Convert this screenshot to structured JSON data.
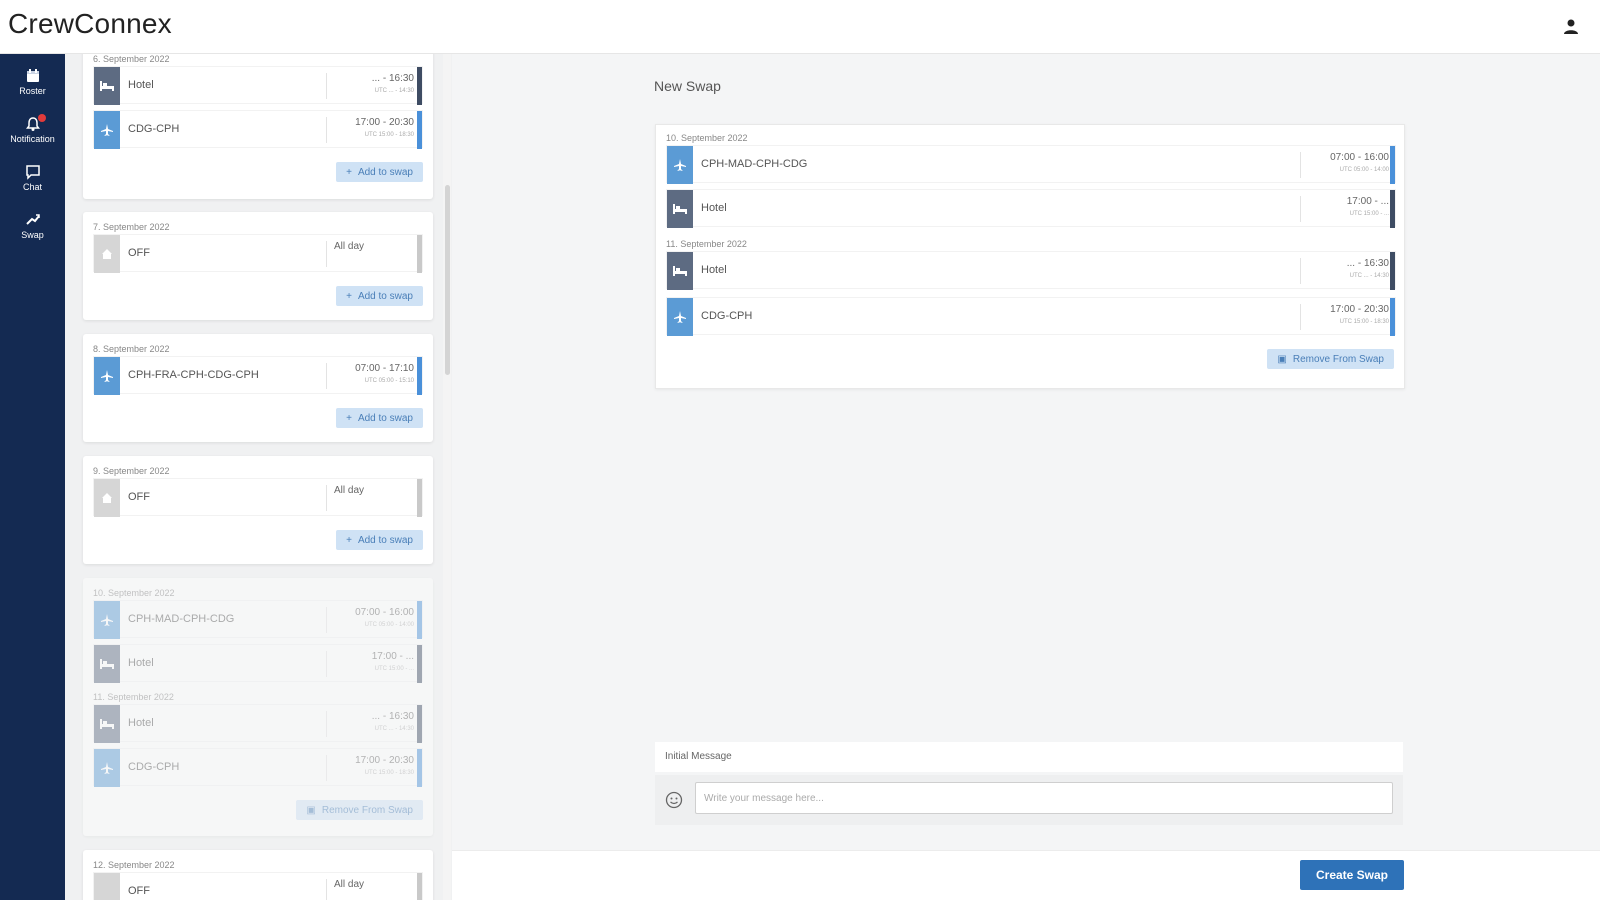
{
  "app": {
    "title": "CrewConnex"
  },
  "nav": {
    "items": [
      {
        "label": "Roster",
        "icon": "calendar-icon"
      },
      {
        "label": "Notification",
        "icon": "bell-icon",
        "badge": true
      },
      {
        "label": "Chat",
        "icon": "chat-icon"
      },
      {
        "label": "Swap",
        "icon": "swap-icon"
      }
    ]
  },
  "colors": {
    "sidebar": "#142a52",
    "flight": "#5b9bd5",
    "hotel": "#5d6b82",
    "primary": "#2e72b8",
    "badge": "#e23b3b"
  },
  "roster_list": {
    "cards": [
      {
        "date": "6. September 2022",
        "duties": [
          {
            "type": "hotel",
            "name": "Hotel",
            "time": "... - 16:30",
            "utc": "UTC ... - 14:30"
          },
          {
            "type": "flight",
            "name": "CDG-CPH",
            "time": "17:00 - 20:30",
            "utc": "UTC 15:00 - 18:30"
          }
        ],
        "action": "Add to swap"
      },
      {
        "date": "7. September 2022",
        "duties": [
          {
            "type": "off",
            "name": "OFF",
            "time": "All day",
            "utc": ""
          }
        ],
        "action": "Add to swap"
      },
      {
        "date": "8. September 2022",
        "duties": [
          {
            "type": "flight",
            "name": "CPH-FRA-CPH-CDG-CPH",
            "time": "07:00 - 17:10",
            "utc": "UTC 05:00 - 15:10"
          }
        ],
        "action": "Add to swap"
      },
      {
        "date": "9. September 2022",
        "duties": [
          {
            "type": "off",
            "name": "OFF",
            "time": "All day",
            "utc": ""
          }
        ],
        "action": "Add to swap"
      },
      {
        "date": "10. September 2022",
        "duties": [
          {
            "type": "flight",
            "name": "CPH-MAD-CPH-CDG",
            "time": "07:00 - 16:00",
            "utc": "UTC 05:00 - 14:00"
          },
          {
            "type": "hotel",
            "name": "Hotel",
            "time": "17:00 - ...",
            "utc": "UTC 15:00 - ..."
          }
        ],
        "date2": "11. September 2022",
        "duties2": [
          {
            "type": "hotel",
            "name": "Hotel",
            "time": "... - 16:30",
            "utc": "UTC ... - 14:30"
          },
          {
            "type": "flight",
            "name": "CDG-CPH",
            "time": "17:00 - 20:30",
            "utc": "UTC 15:00 - 18:30"
          }
        ],
        "action": "Remove From Swap"
      },
      {
        "date": "12. September 2022",
        "duties": [
          {
            "type": "off",
            "name": "OFF",
            "time": "All day",
            "utc": ""
          }
        ]
      }
    ]
  },
  "new_swap": {
    "title": "New Swap",
    "groups": [
      {
        "date": "10. September 2022",
        "duties": [
          {
            "type": "flight",
            "name": "CPH-MAD-CPH-CDG",
            "time": "07:00 - 16:00",
            "utc": "UTC 05:00 - 14:00"
          },
          {
            "type": "hotel",
            "name": "Hotel",
            "time": "17:00 - ...",
            "utc": "UTC 15:00 - ..."
          }
        ]
      },
      {
        "date": "11. September 2022",
        "duties": [
          {
            "type": "hotel",
            "name": "Hotel",
            "time": "... - 16:30",
            "utc": "UTC ... - 14:30"
          },
          {
            "type": "flight",
            "name": "CDG-CPH",
            "time": "17:00 - 20:30",
            "utc": "UTC 15:00 - 18:30"
          }
        ]
      }
    ],
    "remove_label": "Remove From Swap"
  },
  "message": {
    "label": "Initial Message",
    "placeholder": "Write your message here..."
  },
  "footer": {
    "create_label": "Create Swap"
  }
}
